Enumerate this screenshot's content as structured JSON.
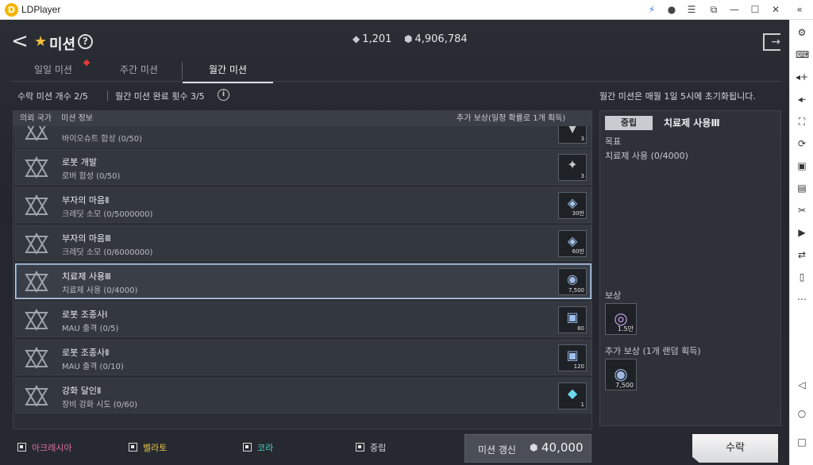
{
  "window": {
    "app_title": "LDPlayer",
    "logo_letter": "D"
  },
  "header": {
    "title": "미션",
    "help_glyph": "?",
    "currencies": [
      {
        "icon": "gem-icon",
        "value": "1,201"
      },
      {
        "icon": "credit-icon",
        "value": "4,906,784"
      }
    ]
  },
  "tabs": [
    {
      "label": "일일 미션",
      "active": false,
      "has_alert": true
    },
    {
      "label": "주간 미션",
      "active": false,
      "has_alert": false
    },
    {
      "label": "월간 미션",
      "active": true,
      "has_alert": false
    }
  ],
  "info": {
    "accepted_count": "수락 미션 개수 2/5",
    "monthly_clear": "월간 미션 완료 횟수 3/5",
    "reset_notice": "월간 미션은 매월 1일 5시에 초기화됩니다."
  },
  "list": {
    "headers": {
      "nation": "의뢰 국가",
      "mission": "미션 정보",
      "reward": "추가 보상(일정 확률로 1개 획득)"
    },
    "rows": [
      {
        "name": "",
        "desc": "바이오슈트 합성 (0/50)",
        "reward_icon": "suit-icon",
        "reward_qty": "3",
        "selected": false
      },
      {
        "name": "로봇 개발",
        "desc": "로버 합성 (0/50)",
        "reward_icon": "rover-icon",
        "reward_qty": "3",
        "selected": false
      },
      {
        "name": "부자의 마음Ⅱ",
        "desc": "크레딧 소모 (0/5000000)",
        "reward_icon": "credit-chest-icon",
        "reward_qty": "30만",
        "selected": false
      },
      {
        "name": "부자의 마음Ⅲ",
        "desc": "크레딧 소모 (0/6000000)",
        "reward_icon": "credit-chest-icon",
        "reward_qty": "60만",
        "selected": false
      },
      {
        "name": "치료제 사용Ⅲ",
        "desc": "치료제 사용 (0/4000)",
        "reward_icon": "coin-stack-icon",
        "reward_qty": "7,500",
        "selected": true
      },
      {
        "name": "로봇 조종사Ⅰ",
        "desc": "MAU 출격 (0/5)",
        "reward_icon": "cube-icon",
        "reward_qty": "80",
        "selected": false
      },
      {
        "name": "로봇 조종사Ⅱ",
        "desc": "MAU 출격 (0/10)",
        "reward_icon": "cube-icon",
        "reward_qty": "120",
        "selected": false
      },
      {
        "name": "강화 달인Ⅱ",
        "desc": "장비 강화 시도 (0/60)",
        "reward_icon": "crystal-icon",
        "reward_qty": "1",
        "selected": false
      }
    ]
  },
  "detail": {
    "faction_badge": "중립",
    "title": "치료제 사용Ⅲ",
    "goal_label": "목표",
    "goal_text": "치료제 사용 (0/4000)",
    "reward_label": "보상",
    "reward_qty": "1.5만",
    "extra_label": "추가 보상 (1개 랜덤 획득)",
    "extra_qty": "7,500"
  },
  "filters": [
    {
      "label": "아크레시아",
      "color": "#e0709a"
    },
    {
      "label": "벨라토",
      "color": "#e8c24a"
    },
    {
      "label": "코라",
      "color": "#4fd0c8"
    },
    {
      "label": "중립",
      "color": "#d4d6da"
    }
  ],
  "footer": {
    "refresh_label": "미션 갱신",
    "refresh_cost": "40,000",
    "accept_label": "수락"
  }
}
